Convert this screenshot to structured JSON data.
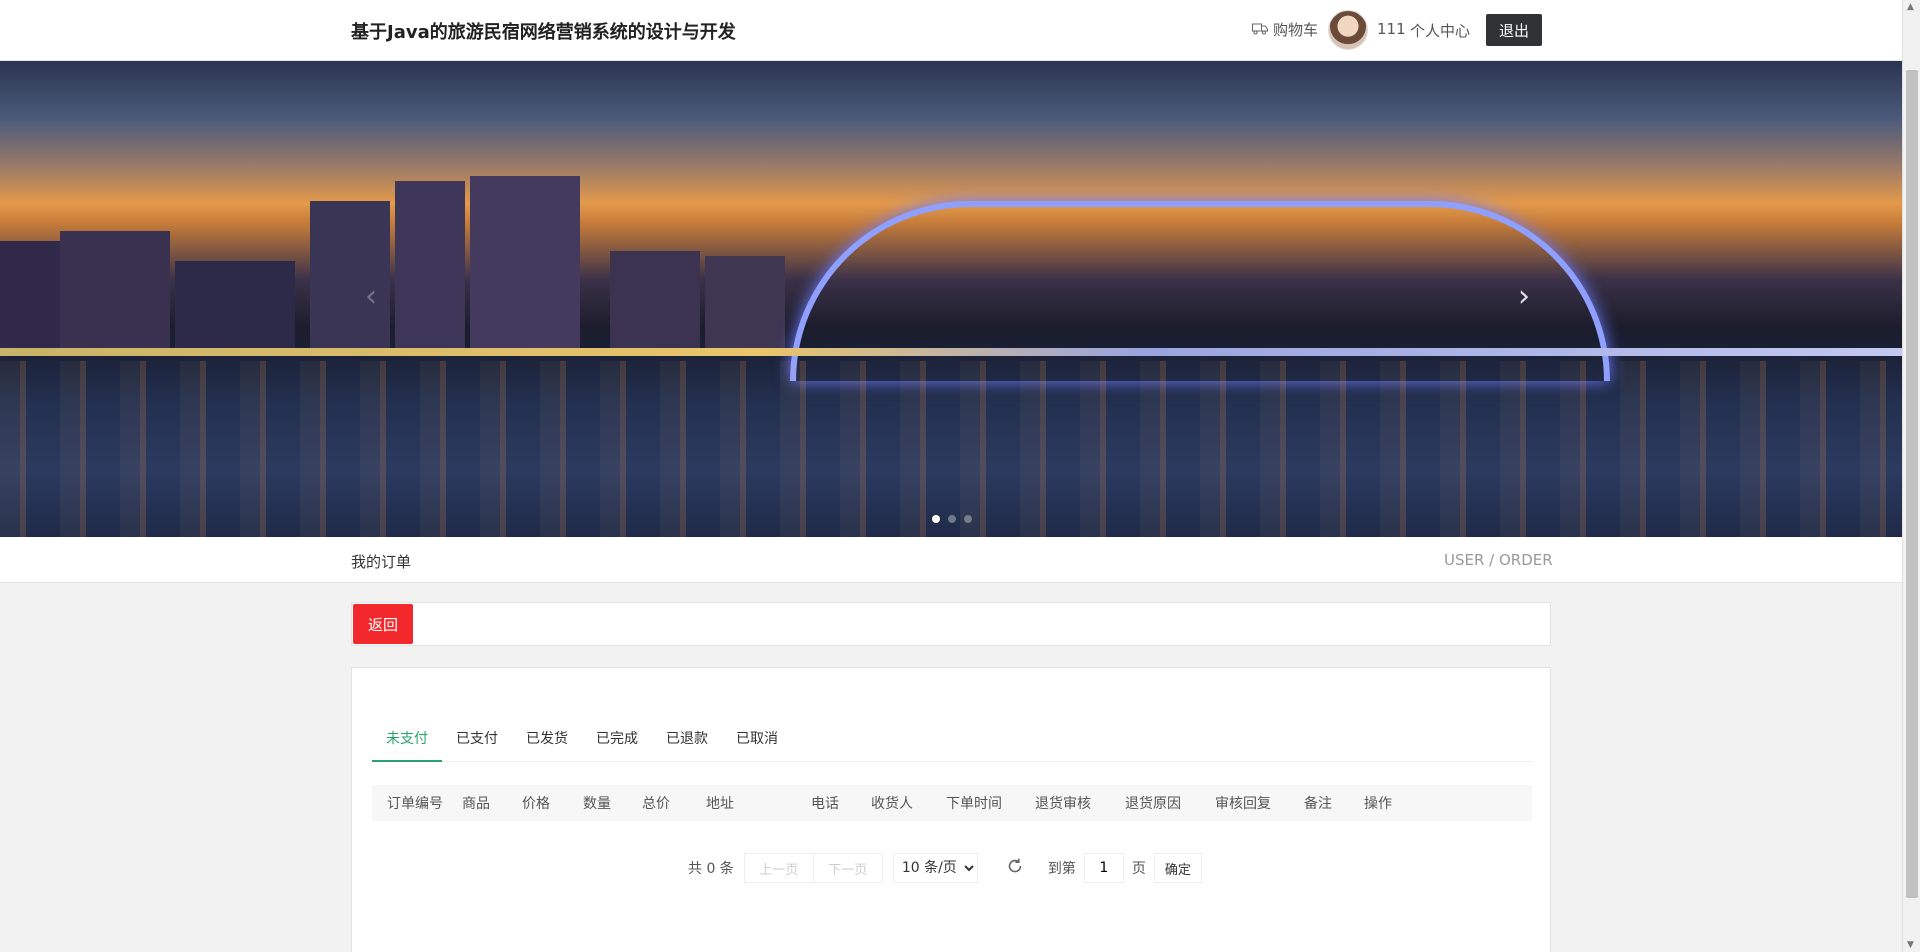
{
  "header": {
    "title": "基于Java的旅游民宿网络营销系统的设计与开发",
    "cart_label": "购物车",
    "username": "111",
    "center_label": "个人中心",
    "logout_label": "退出"
  },
  "banner": {
    "slide_count": 3,
    "active_slide": 1
  },
  "breadcrumb": {
    "title": "我的订单",
    "path": "USER / ORDER"
  },
  "back_label": "返回",
  "tabs": [
    "未支付",
    "已支付",
    "已发货",
    "已完成",
    "已退款",
    "已取消"
  ],
  "active_tab": 0,
  "table": {
    "columns": [
      "订单编号",
      "商品",
      "价格",
      "数量",
      "总价",
      "地址",
      "电话",
      "收货人",
      "下单时间",
      "退货审核",
      "退货原因",
      "审核回复",
      "备注",
      "操作"
    ],
    "rows": []
  },
  "pager": {
    "total": "共 0 条",
    "prev": "上一页",
    "next": "下一页",
    "page_size": "10 条/页",
    "goto_label": "到第",
    "page_value": "1",
    "page_unit": "页",
    "confirm": "确定"
  }
}
